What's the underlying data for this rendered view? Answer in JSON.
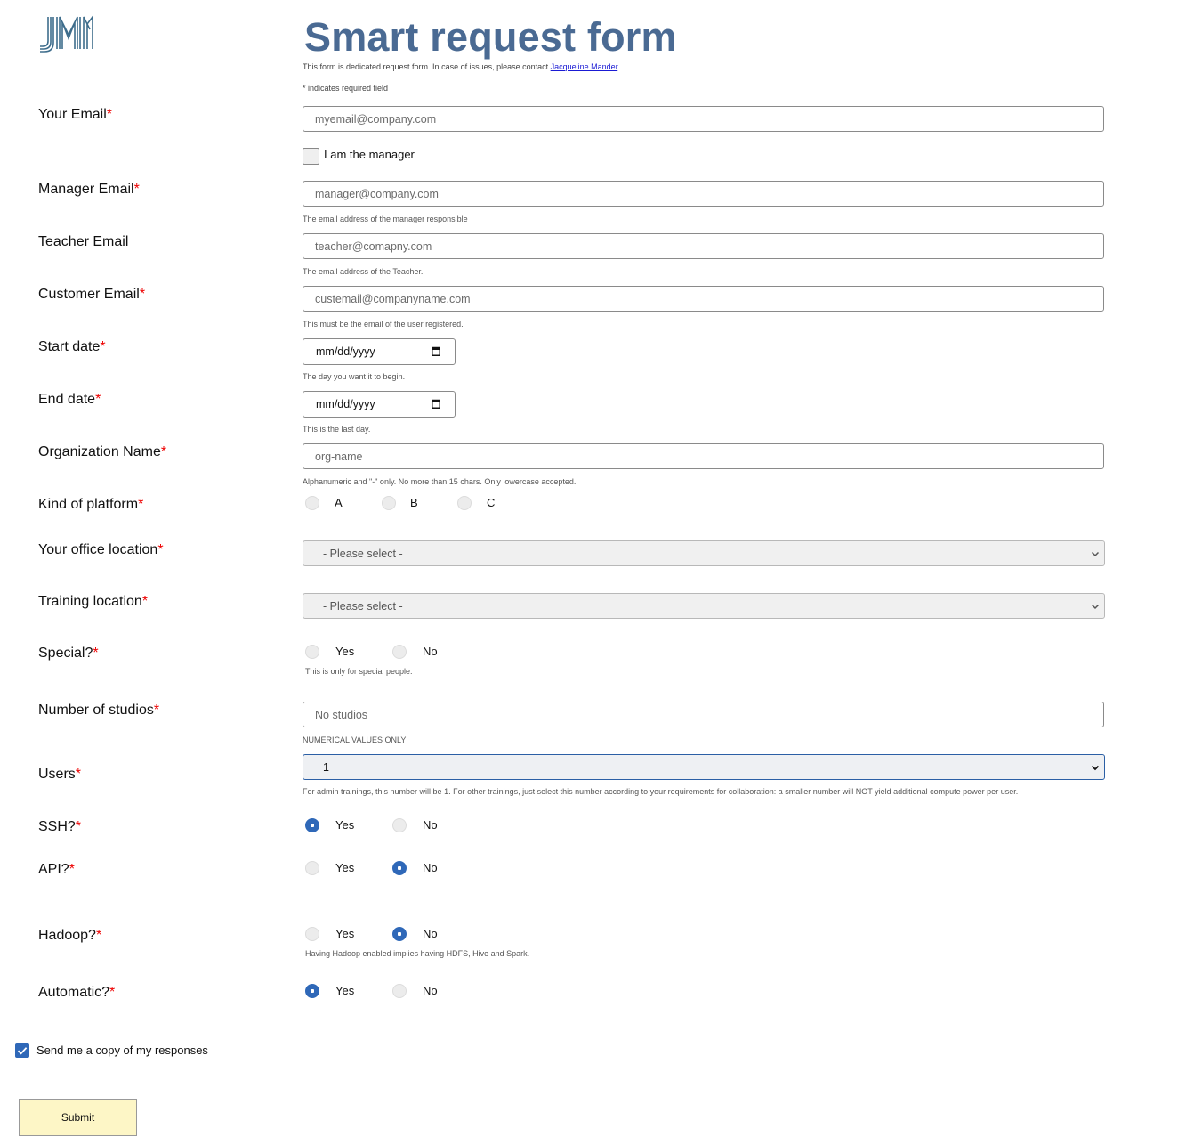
{
  "header": {
    "title": "Smart request form",
    "subtitle_prefix": "This form is dedicated request form. In case of issues, please contact ",
    "contact_link": "Jacqueline Mander",
    "subtitle_suffix": ".",
    "required_note": "* indicates required field",
    "brand_color": "#4a6a93"
  },
  "fields": {
    "your_email": {
      "label": "Your Email",
      "placeholder": "myemail@company.com"
    },
    "i_am_manager": {
      "label": "I am the manager",
      "checked": false
    },
    "manager_email": {
      "label": "Manager Email",
      "placeholder": "manager@company.com",
      "help": "The email address of the manager responsible"
    },
    "teacher_email": {
      "label": "Teacher Email",
      "placeholder": "teacher@comapny.com",
      "help": "The email address of the Teacher."
    },
    "customer_email": {
      "label": "Customer Email",
      "placeholder": "custemail@companyname.com",
      "help": "This must be the email of the user registered."
    },
    "start_date": {
      "label": "Start date",
      "value": "mm/dd/yyyy",
      "help": "The day you want it to begin."
    },
    "end_date": {
      "label": "End date",
      "value": "mm/dd/yyyy",
      "help": "This is the last day."
    },
    "org_name": {
      "label": "Organization Name",
      "placeholder": "org-name",
      "help": "Alphanumeric and \"-\" only. No more than 15 chars. Only lowercase accepted."
    },
    "platform": {
      "label": "Kind of platform",
      "options": [
        "A",
        "B",
        "C"
      ],
      "selected": null
    },
    "office_location": {
      "label": "Your office location",
      "value": "- Please select -"
    },
    "training_location": {
      "label": "Training location",
      "value": "- Please select -"
    },
    "special": {
      "label": "Special?",
      "options": [
        "Yes",
        "No"
      ],
      "selected": null,
      "help": "This is only for special people."
    },
    "studios": {
      "label": "Number of studios",
      "placeholder": "No studios",
      "help": "NUMERICAL VALUES ONLY"
    },
    "users": {
      "label": "Users",
      "value": "1",
      "help": "For admin trainings, this number will be 1. For other trainings, just select this number according to your requirements for collaboration: a smaller number will NOT yield additional compute power per user."
    },
    "ssh": {
      "label": "SSH?",
      "options": [
        "Yes",
        "No"
      ],
      "selected": "Yes"
    },
    "api": {
      "label": "API?",
      "options": [
        "Yes",
        "No"
      ],
      "selected": "No"
    },
    "hadoop": {
      "label": "Hadoop?",
      "options": [
        "Yes",
        "No"
      ],
      "selected": "No",
      "help": "Having Hadoop enabled implies having HDFS, Hive and Spark."
    },
    "automatic": {
      "label": "Automatic?",
      "options": [
        "Yes",
        "No"
      ],
      "selected": "Yes"
    }
  },
  "required_marker": "*",
  "send_copy": {
    "label": "Send me a copy of my responses",
    "checked": true
  },
  "submit": {
    "label": "Submit"
  },
  "colors": {
    "accent": "#2f68b8",
    "required": "#ee0000",
    "submit_bg": "#fdf6c6"
  }
}
